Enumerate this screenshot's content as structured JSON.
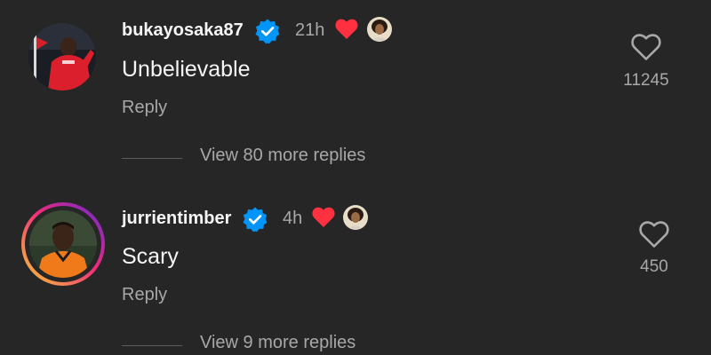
{
  "comments": [
    {
      "username": "bukayosaka87",
      "verified": true,
      "timestamp": "21h",
      "liked_by_author": true,
      "text": "Unbelievable",
      "reply_label": "Reply",
      "like_count": "11245",
      "view_replies_label": "View 80 more replies"
    },
    {
      "username": "jurrientimber",
      "verified": true,
      "timestamp": "4h",
      "liked_by_author": true,
      "text": "Scary",
      "reply_label": "Reply",
      "like_count": "450",
      "view_replies_label": "View 9 more replies"
    }
  ],
  "colors": {
    "background": "#262626",
    "verified_blue": "#0095f6",
    "like_red": "#ff3040",
    "secondary_text": "#a8a8a8"
  },
  "icons": {
    "verified": "verified-badge-icon",
    "author_like": "red-heart-icon",
    "like": "heart-outline-icon"
  }
}
